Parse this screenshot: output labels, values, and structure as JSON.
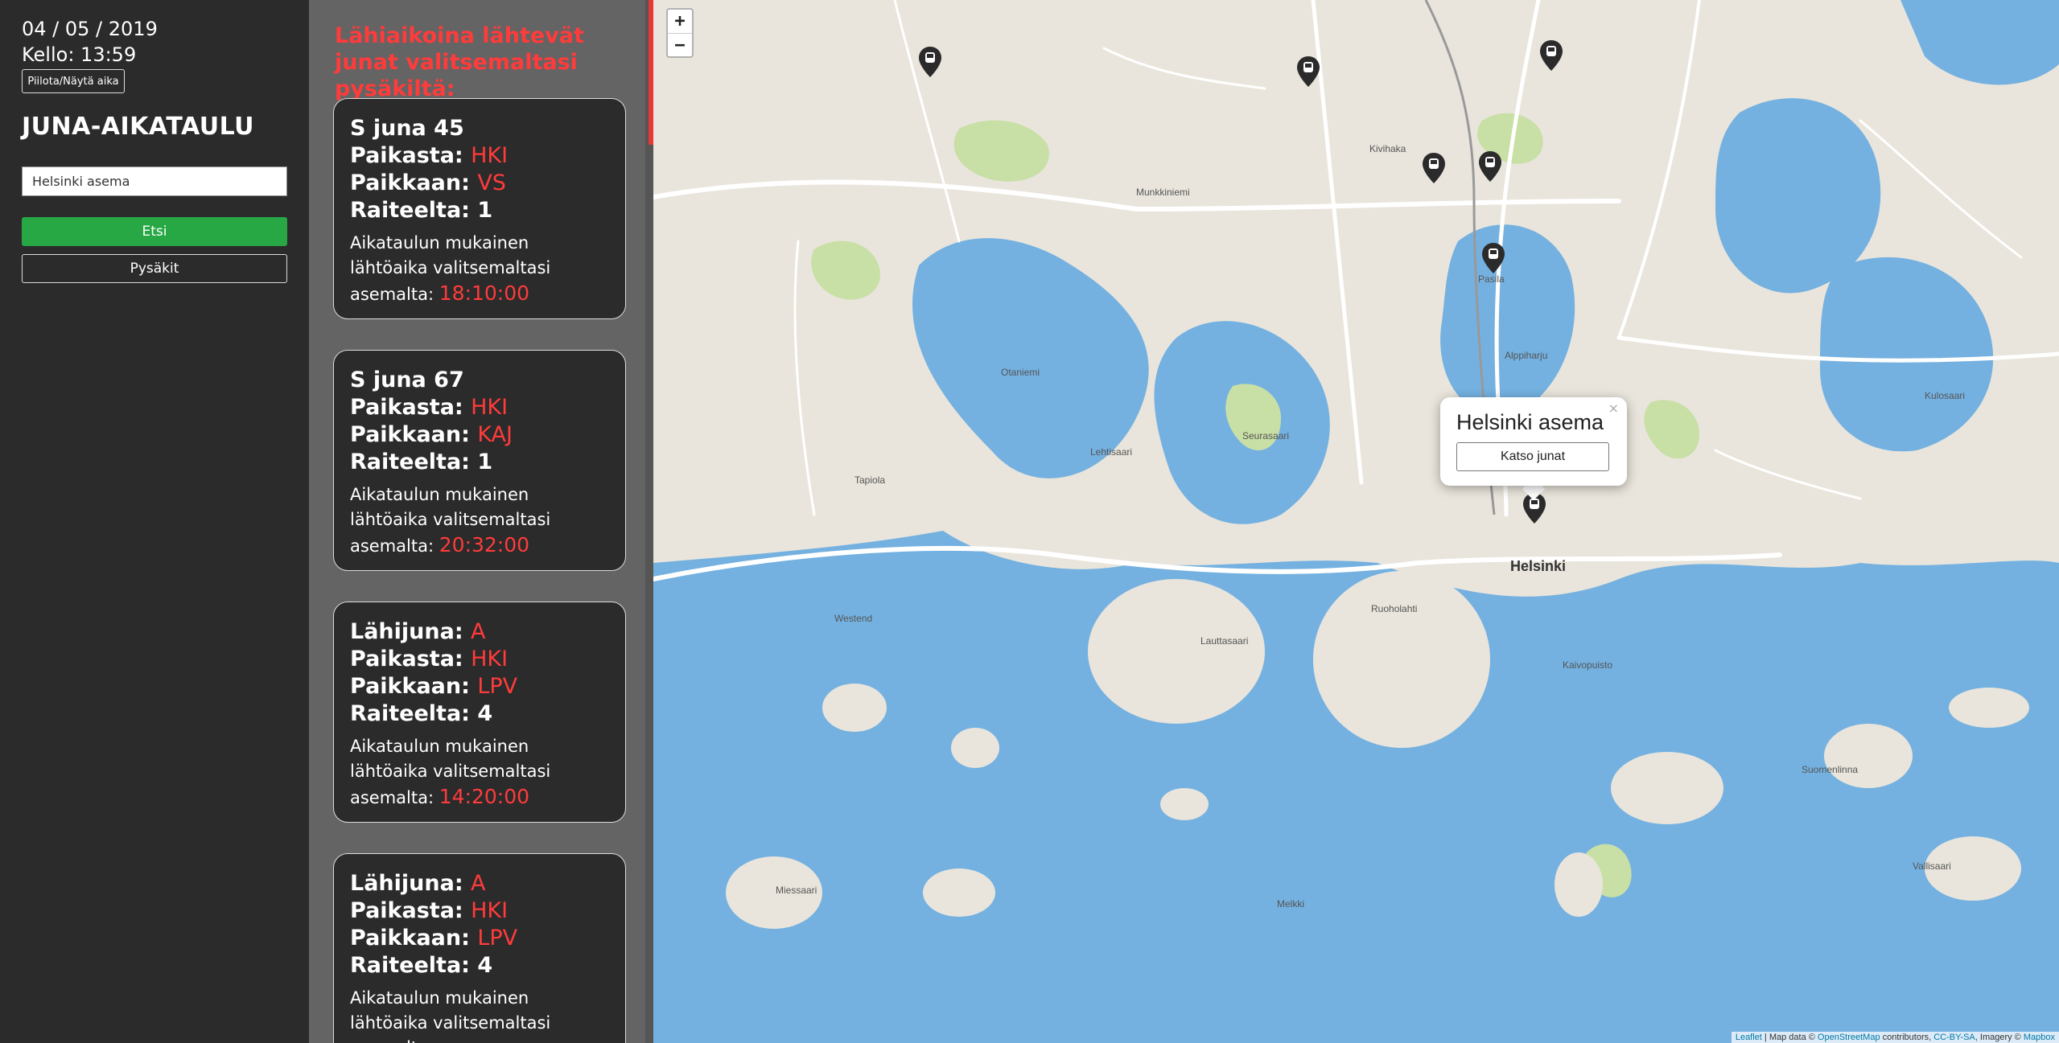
{
  "sidebar": {
    "date": "04 / 05 / 2019",
    "clock": "Kello: 13:59",
    "toggle_label": "Piilota/Näytä aika",
    "title": "JUNA-AIKATAULU",
    "station_input_value": "Helsinki asema",
    "search_label": "Etsi",
    "stops_label": "Pysäkit"
  },
  "list": {
    "heading": "Lähiaikoina lähtevät junat valitsemaltasi pysäkiltä:",
    "from_label": "Paikasta:",
    "to_label": "Paikkaan:",
    "track_label": "Raiteelta:",
    "desc_label": "Aikataulun mukainen lähtöaika valitsemaltasi asemalta:",
    "trains": [
      {
        "type_label": "S juna",
        "id": "45",
        "from": "HKI",
        "to": "VS",
        "track": "1",
        "time": "18:10:00"
      },
      {
        "type_label": "S juna",
        "id": "67",
        "from": "HKI",
        "to": "KAJ",
        "track": "1",
        "time": "20:32:00"
      },
      {
        "type_label": "Lähijuna:",
        "id": "A",
        "from": "HKI",
        "to": "LPV",
        "track": "4",
        "time": "14:20:00"
      },
      {
        "type_label": "Lähijuna:",
        "id": "A",
        "from": "HKI",
        "to": "LPV",
        "track": "4",
        "time": ""
      }
    ]
  },
  "map": {
    "zoom_in": "+",
    "zoom_out": "−",
    "popup_title": "Helsinki asema",
    "popup_close": "×",
    "popup_button": "Katso junat",
    "places": {
      "helsinki": "Helsinki",
      "pasila": "Pasila",
      "lauttasaari": "Lauttasaari",
      "otaniemi": "Otaniemi",
      "tapiola": "Tapiola",
      "westend": "Westend",
      "kivihaka": "Kivihaka",
      "alppiharju": "Alppiharju",
      "ruoholahti": "Ruoholahti",
      "kaivopuisto": "Kaivopuisto",
      "seurasaari": "Seurasaari",
      "lehtisaari": "Lehtisaari",
      "munkkiniemi": "Munkkiniemi",
      "suomenlinna": "Suomenlinna",
      "vallisaari": "Vallisaari",
      "kulosaari": "Kulosaari",
      "miessaari": "Miessaari",
      "melkki": "Melkki"
    },
    "attribution": {
      "leaflet": "Leaflet",
      "map_data": " | Map data © ",
      "osm": "OpenStreetMap",
      "contributors": " contributors, ",
      "license": "CC-BY-SA",
      "imagery": ", Imagery © ",
      "mapbox": "Mapbox"
    },
    "colors": {
      "water": "#74b1e0",
      "land": "#e9e5dc",
      "park": "#c8dfa6",
      "road": "#ffffff",
      "marker": "#2b2b2b"
    }
  }
}
